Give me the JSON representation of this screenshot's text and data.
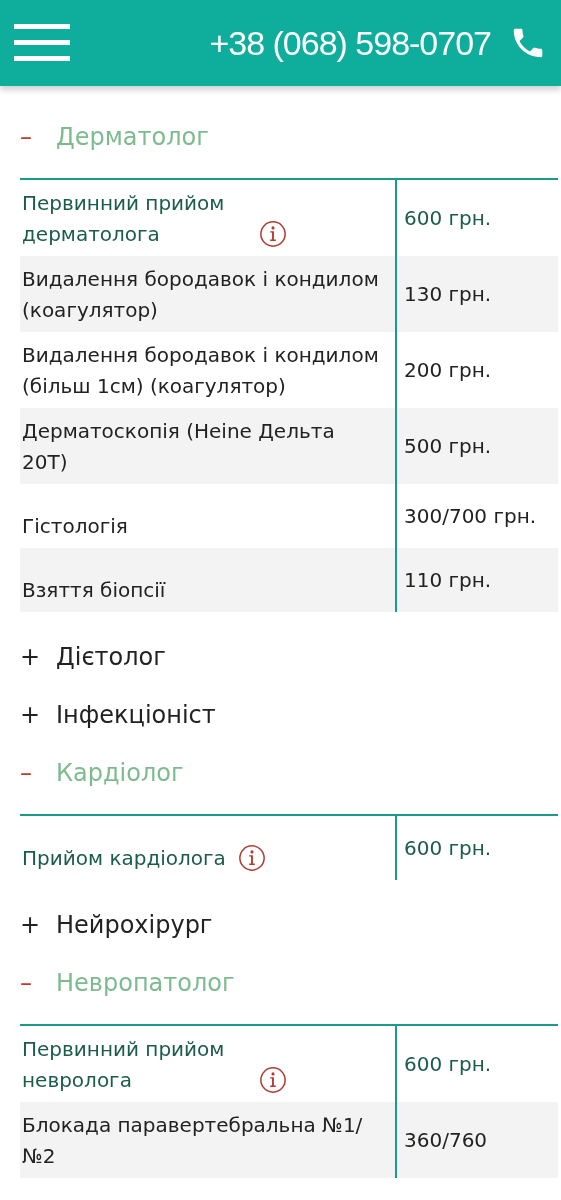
{
  "header": {
    "phone": "+38 (068) 598-0707"
  },
  "sections": [
    {
      "sign": "–",
      "title": "Дерматолог",
      "expanded": true,
      "rows": [
        {
          "service": "Первинний прийом дерматолога",
          "price": "600 грн.",
          "info": true
        },
        {
          "service": "Видалення бородавок і кондилом (коагулятор)",
          "price": "130 грн.",
          "info": false
        },
        {
          "service": "Видалення бородавок і кондилом (більш 1см) (коагулятор)",
          "price": "200 грн.",
          "info": false
        },
        {
          "service": "Дерматоскопія (Heine Дельта 20T)",
          "price": "500 грн.",
          "info": false
        },
        {
          "service": "Гістологія",
          "price": "300/700 грн.",
          "info": false
        },
        {
          "service": "Взяття біопсії",
          "price": "110 грн.",
          "info": false
        }
      ]
    },
    {
      "sign": "+",
      "title": "Дієтолог",
      "expanded": false
    },
    {
      "sign": "+",
      "title": "Інфекціоніст",
      "expanded": false
    },
    {
      "sign": "–",
      "title": "Кардіолог",
      "expanded": true,
      "rows": [
        {
          "service": "Прийом кардіолога",
          "price": "600 грн.",
          "info": true
        }
      ]
    },
    {
      "sign": "+",
      "title": "Нейрохірург",
      "expanded": false
    },
    {
      "sign": "–",
      "title": "Невропатолог",
      "expanded": true,
      "rows": [
        {
          "service": "Первинний прийом невролога",
          "price": "600 грн.",
          "info": true
        },
        {
          "service": "Блокада паравертебральна №1/ №2",
          "price": "360/760",
          "info": false
        }
      ]
    }
  ]
}
